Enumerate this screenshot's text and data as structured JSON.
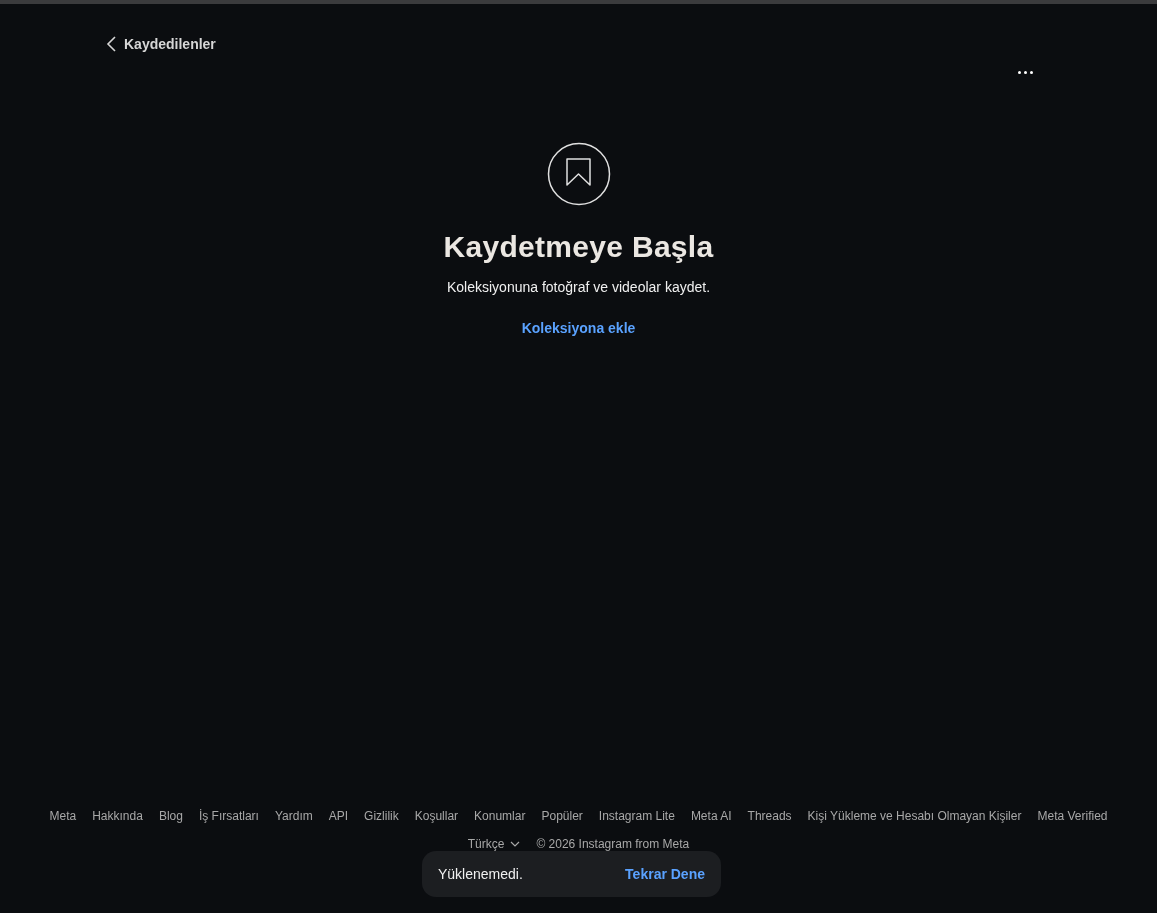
{
  "header": {
    "back_label": "Kaydedilenler"
  },
  "empty_state": {
    "title": "Kaydetmeye Başla",
    "description": "Koleksiyonuna fotoğraf ve videolar kaydet.",
    "action": "Koleksiyona ekle"
  },
  "footer": {
    "links": [
      "Meta",
      "Hakkında",
      "Blog",
      "İş Fırsatları",
      "Yardım",
      "API",
      "Gizlilik",
      "Koşullar",
      "Konumlar",
      "Popüler",
      "Instagram Lite",
      "Meta AI",
      "Threads",
      "Kişi Yükleme ve Hesabı Olmayan Kişiler",
      "Meta Verified"
    ],
    "language": "Türkçe",
    "copyright": "© 2026 Instagram from Meta"
  },
  "toast": {
    "message": "Yüklenemedi.",
    "action": "Tekrar Dene"
  }
}
